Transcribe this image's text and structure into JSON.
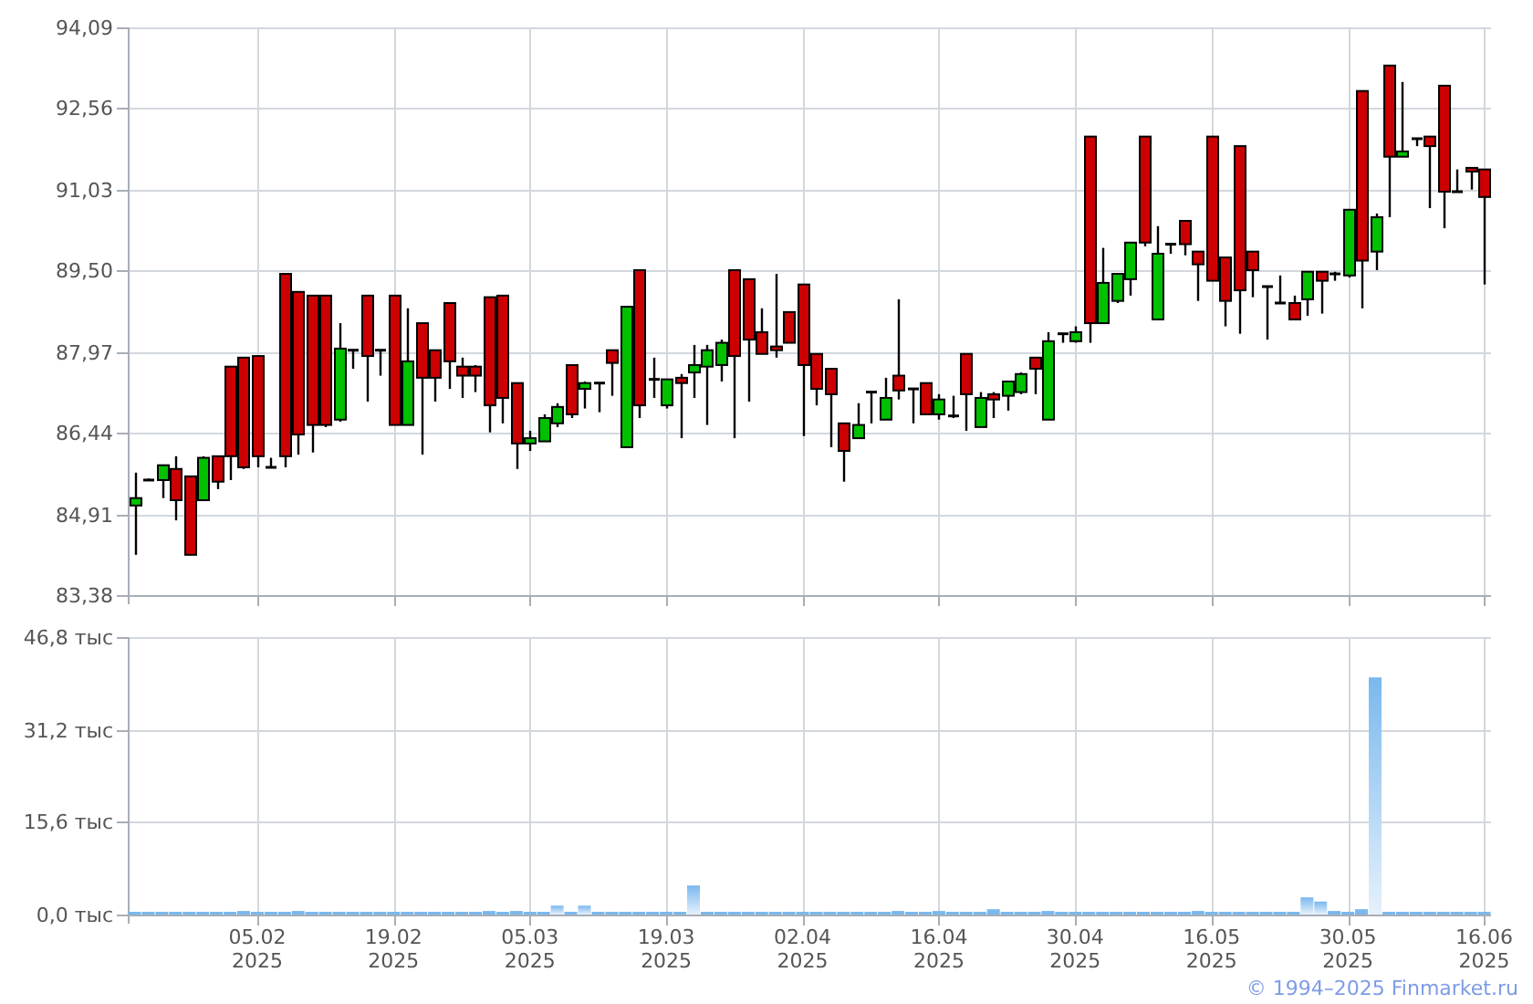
{
  "price_chart": {
    "chart_data": {
      "type": "candlestick",
      "grid": true,
      "categories": [
        null,
        null,
        null,
        null,
        null,
        null,
        null,
        null,
        null,
        null,
        null,
        null,
        null,
        null,
        null,
        null,
        null,
        null,
        null,
        null,
        null,
        null,
        null,
        null,
        null,
        null,
        null,
        null,
        null,
        null,
        null,
        null,
        null,
        null,
        null,
        null,
        null,
        null,
        null,
        null,
        null,
        null,
        null,
        null,
        null,
        null,
        null,
        null,
        null,
        null,
        null,
        null,
        null,
        null,
        null,
        null,
        null,
        null,
        null,
        null,
        null,
        null,
        null,
        null,
        null,
        null,
        null,
        null,
        null,
        null,
        null,
        null,
        null,
        null,
        null,
        null,
        null,
        null,
        null,
        null,
        null,
        null,
        null,
        null,
        null,
        null,
        null,
        null,
        null,
        null,
        null,
        null,
        null,
        null,
        null,
        null,
        null,
        null,
        null,
        null
      ],
      "ylim": [
        83.38,
        94.09
      ],
      "yticks": [
        {
          "value": 83.38,
          "label": "83,38"
        },
        {
          "value": 84.91,
          "label": "84,91"
        },
        {
          "value": 86.44,
          "label": "86,44"
        },
        {
          "value": 87.97,
          "label": "87,97"
        },
        {
          "value": 89.5,
          "label": "89,50"
        },
        {
          "value": 91.03,
          "label": "91,03"
        },
        {
          "value": 92.56,
          "label": "92,56"
        },
        {
          "value": 94.09,
          "label": "94,09"
        }
      ],
      "ohlc": [
        [
          85.07,
          85.69,
          84.14,
          85.21
        ],
        [
          85.55,
          85.58,
          85.55,
          85.55
        ],
        [
          85.55,
          85.83,
          85.21,
          85.83
        ],
        [
          85.76,
          86.0,
          84.79,
          85.17
        ],
        [
          85.62,
          85.62,
          84.14,
          84.14
        ],
        [
          85.17,
          86.0,
          85.17,
          85.97
        ],
        [
          86.0,
          86.0,
          85.38,
          85.52
        ],
        [
          87.69,
          87.69,
          85.55,
          86.0
        ],
        [
          87.86,
          87.86,
          85.76,
          85.79
        ],
        [
          87.89,
          87.89,
          85.79,
          86.0
        ],
        [
          85.79,
          85.97,
          85.79,
          85.79
        ],
        [
          89.44,
          89.44,
          85.79,
          86.0
        ],
        [
          89.1,
          89.1,
          86.03,
          86.41
        ],
        [
          89.03,
          89.03,
          86.07,
          86.59
        ],
        [
          89.03,
          89.03,
          86.55,
          86.59
        ],
        [
          86.69,
          88.51,
          86.65,
          88.03
        ],
        [
          88.0,
          88.0,
          87.65,
          88.0
        ],
        [
          89.03,
          89.03,
          87.03,
          87.89
        ],
        [
          88.0,
          88.0,
          87.52,
          88.0
        ],
        [
          89.03,
          89.03,
          86.59,
          86.59
        ],
        [
          86.59,
          88.79,
          86.59,
          87.79
        ],
        [
          88.51,
          88.51,
          86.03,
          87.48
        ],
        [
          88.0,
          88.0,
          87.03,
          87.48
        ],
        [
          88.89,
          88.89,
          87.27,
          87.79
        ],
        [
          87.69,
          87.86,
          87.1,
          87.52
        ],
        [
          87.69,
          87.72,
          87.21,
          87.52
        ],
        [
          89.0,
          89.0,
          86.45,
          86.96
        ],
        [
          89.03,
          89.03,
          86.62,
          87.1
        ],
        [
          87.38,
          87.38,
          85.76,
          86.24
        ],
        [
          86.24,
          86.48,
          86.1,
          86.34
        ],
        [
          86.28,
          86.79,
          86.28,
          86.72
        ],
        [
          86.62,
          87.0,
          86.55,
          86.93
        ],
        [
          87.72,
          87.72,
          86.72,
          86.79
        ],
        [
          87.27,
          87.41,
          86.9,
          87.38
        ],
        [
          87.38,
          87.38,
          86.83,
          87.38
        ],
        [
          88.0,
          88.0,
          87.14,
          87.76
        ],
        [
          86.17,
          88.82,
          86.17,
          88.82
        ],
        [
          89.51,
          89.51,
          86.72,
          86.96
        ],
        [
          87.45,
          87.86,
          87.1,
          87.45
        ],
        [
          86.96,
          87.45,
          86.9,
          87.45
        ],
        [
          87.48,
          87.55,
          86.34,
          87.38
        ],
        [
          87.58,
          88.1,
          87.1,
          87.72
        ],
        [
          87.69,
          88.1,
          86.59,
          88.0
        ],
        [
          87.72,
          88.2,
          87.41,
          88.14
        ],
        [
          89.51,
          89.51,
          86.34,
          87.89
        ],
        [
          89.34,
          89.34,
          87.03,
          88.2
        ],
        [
          88.34,
          88.79,
          87.93,
          87.93
        ],
        [
          88.07,
          89.44,
          87.86,
          88.0
        ],
        [
          88.72,
          88.72,
          88.14,
          88.14
        ],
        [
          89.24,
          89.24,
          86.38,
          87.72
        ],
        [
          87.93,
          87.93,
          86.96,
          87.27
        ],
        [
          87.65,
          87.65,
          86.17,
          87.17
        ],
        [
          86.62,
          86.62,
          85.52,
          86.1
        ],
        [
          86.34,
          87.0,
          86.34,
          86.59
        ],
        [
          87.21,
          87.21,
          86.62,
          87.21
        ],
        [
          86.69,
          87.48,
          86.69,
          87.1
        ],
        [
          87.52,
          88.96,
          87.07,
          87.24
        ],
        [
          87.27,
          87.27,
          86.62,
          87.27
        ],
        [
          87.38,
          87.38,
          86.79,
          86.79
        ],
        [
          86.79,
          87.17,
          86.69,
          87.07
        ],
        [
          86.76,
          87.14,
          86.72,
          86.76
        ],
        [
          87.93,
          87.93,
          86.48,
          87.17
        ],
        [
          86.55,
          87.21,
          86.55,
          87.1
        ],
        [
          87.17,
          87.21,
          86.72,
          87.07
        ],
        [
          87.14,
          87.41,
          86.86,
          87.41
        ],
        [
          87.21,
          87.58,
          87.17,
          87.55
        ],
        [
          87.86,
          87.86,
          87.17,
          87.65
        ],
        [
          86.69,
          88.34,
          86.69,
          88.17
        ],
        [
          88.31,
          88.31,
          88.14,
          88.31
        ],
        [
          88.17,
          88.45,
          88.14,
          88.34
        ],
        [
          92.03,
          92.03,
          88.14,
          88.51
        ],
        [
          88.51,
          89.93,
          88.51,
          89.27
        ],
        [
          88.93,
          89.44,
          88.89,
          89.44
        ],
        [
          89.34,
          90.03,
          89.03,
          90.03
        ],
        [
          92.03,
          92.03,
          89.96,
          90.03
        ],
        [
          88.58,
          90.34,
          88.58,
          89.82
        ],
        [
          90.0,
          90.0,
          89.82,
          90.0
        ],
        [
          90.44,
          90.44,
          89.79,
          90.0
        ],
        [
          89.86,
          89.86,
          88.93,
          89.62
        ],
        [
          92.03,
          92.03,
          89.31,
          89.31
        ],
        [
          89.75,
          89.75,
          88.45,
          88.93
        ],
        [
          91.85,
          91.85,
          88.31,
          89.13
        ],
        [
          89.86,
          89.86,
          89.0,
          89.51
        ],
        [
          89.2,
          89.2,
          88.2,
          89.2
        ],
        [
          88.89,
          89.41,
          88.89,
          88.89
        ],
        [
          88.89,
          89.03,
          88.58,
          88.58
        ],
        [
          88.96,
          89.48,
          88.65,
          89.48
        ],
        [
          89.48,
          89.48,
          88.69,
          89.31
        ],
        [
          89.44,
          89.48,
          89.31,
          89.44
        ],
        [
          89.41,
          90.65,
          89.37,
          90.65
        ],
        [
          92.89,
          92.89,
          88.79,
          89.69
        ],
        [
          89.86,
          90.58,
          89.51,
          90.51
        ],
        [
          93.37,
          93.37,
          90.51,
          91.65
        ],
        [
          91.65,
          93.06,
          91.65,
          91.75
        ],
        [
          91.99,
          91.99,
          91.85,
          91.99
        ],
        [
          92.03,
          92.03,
          90.68,
          91.85
        ],
        [
          92.99,
          92.99,
          90.3,
          90.99
        ],
        [
          90.99,
          91.41,
          90.99,
          90.99
        ],
        [
          91.44,
          91.44,
          91.03,
          91.37
        ],
        [
          91.41,
          91.41,
          89.24,
          90.89
        ]
      ]
    }
  },
  "volume_chart": {
    "chart_data": {
      "type": "bar",
      "grid": true,
      "categories": [
        null,
        null,
        null,
        null,
        null,
        null,
        null,
        null,
        null,
        "05.02\n2025",
        null,
        null,
        null,
        null,
        null,
        null,
        null,
        null,
        null,
        "19.02\n2025",
        null,
        null,
        null,
        null,
        null,
        null,
        null,
        null,
        null,
        "05.03\n2025",
        null,
        null,
        null,
        null,
        null,
        null,
        null,
        null,
        null,
        "19.03\n2025",
        null,
        null,
        null,
        null,
        null,
        null,
        null,
        null,
        null,
        "02.04\n2025",
        null,
        null,
        null,
        null,
        null,
        null,
        null,
        null,
        null,
        "16.04\n2025",
        null,
        null,
        null,
        null,
        null,
        null,
        null,
        null,
        null,
        "30.04\n2025",
        null,
        null,
        null,
        null,
        null,
        null,
        null,
        null,
        null,
        "16.05\n2025",
        null,
        null,
        null,
        null,
        null,
        null,
        null,
        null,
        null,
        "30.05\n2025",
        null,
        null,
        null,
        null,
        null,
        null,
        null,
        null,
        null,
        "16.06\n2025"
      ],
      "ylim": [
        0,
        46.8
      ],
      "yticks": [
        {
          "value": 0,
          "label": "0,0 тыс"
        },
        {
          "value": 15.6,
          "label": "15,6 тыс"
        },
        {
          "value": 31.2,
          "label": "31,2 тыс"
        },
        {
          "value": 46.8,
          "label": "46,8 тыс"
        }
      ],
      "series": [
        {
          "color": "#7ab8ee",
          "values": [
            0.4,
            0.4,
            0.4,
            0.4,
            0.4,
            0.4,
            0.4,
            0.4,
            0.6,
            0.4,
            0.4,
            0.4,
            0.6,
            0.4,
            0.4,
            0.4,
            0.4,
            0.4,
            0.4,
            0.4,
            0.4,
            0.4,
            0.4,
            0.4,
            0.4,
            0.4,
            0.6,
            0.4,
            0.6,
            0.4,
            0.4,
            1.5,
            0.4,
            1.5,
            0.4,
            0.4,
            0.4,
            0.4,
            0.4,
            0.4,
            0.4,
            4.9,
            0.4,
            0.4,
            0.4,
            0.4,
            0.4,
            0.4,
            0.4,
            0.4,
            0.4,
            0.4,
            0.4,
            0.4,
            0.4,
            0.4,
            0.6,
            0.4,
            0.4,
            0.6,
            0.4,
            0.4,
            0.4,
            0.9,
            0.4,
            0.4,
            0.4,
            0.6,
            0.4,
            0.4,
            0.4,
            0.4,
            0.4,
            0.4,
            0.4,
            0.4,
            0.4,
            0.4,
            0.6,
            0.4,
            0.4,
            0.4,
            0.4,
            0.4,
            0.4,
            0.4,
            2.9,
            2.2,
            0.6,
            0.4,
            0.9,
            40.0,
            0.4,
            0.4,
            0.4,
            0.4,
            0.4,
            0.4,
            0.4,
            0.4
          ]
        }
      ]
    }
  },
  "copyright": "© 1994–2025 Finmarket.ru"
}
